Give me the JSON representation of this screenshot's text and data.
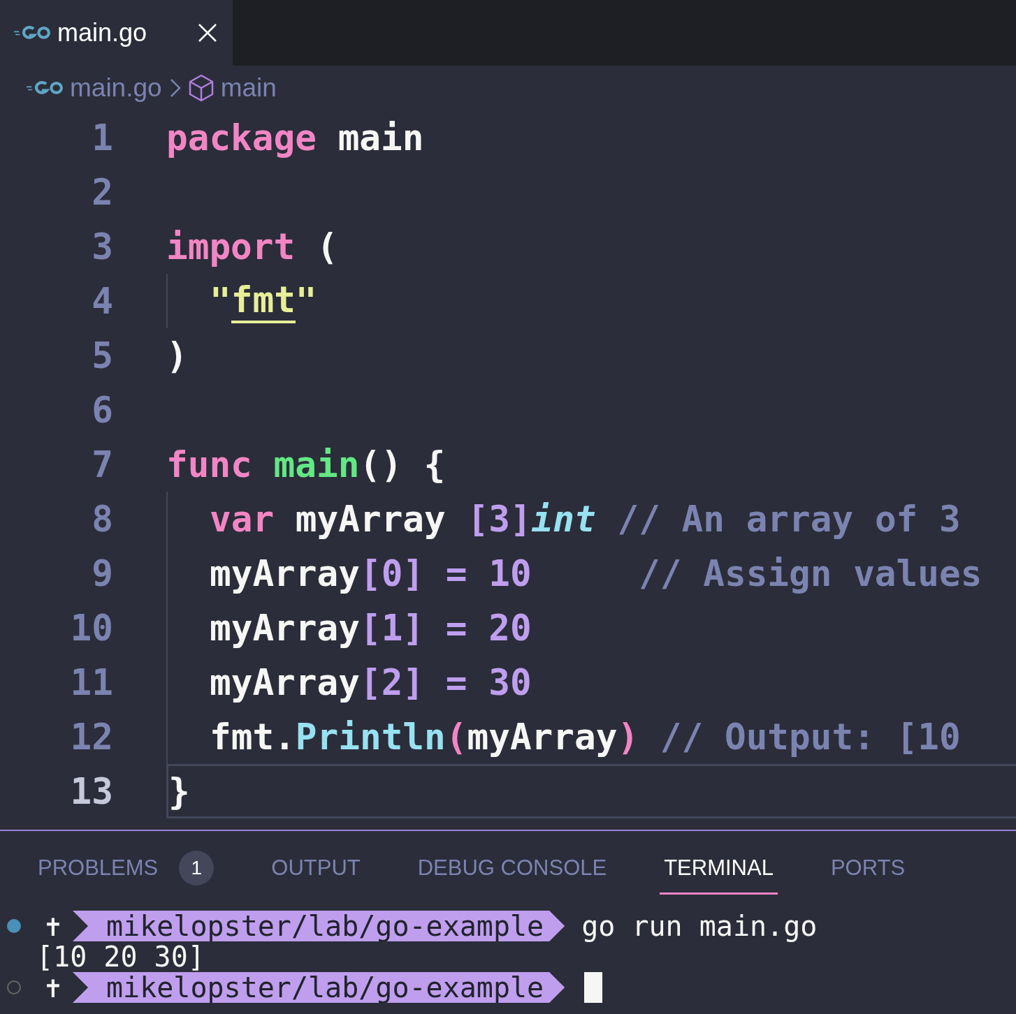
{
  "tab": {
    "label": "main.go",
    "selected": true
  },
  "breadcrumb": [
    {
      "kind": "file",
      "label": "main.go"
    },
    {
      "kind": "symbol",
      "label": "main"
    }
  ],
  "code": [
    {
      "number": "1",
      "indented": false,
      "current": false,
      "tokens": [
        {
          "text": "package",
          "kind": "keyword"
        },
        {
          "text": " main",
          "kind": "plain"
        }
      ]
    },
    {
      "number": "2",
      "current": false
    },
    {
      "number": "3",
      "indented": false,
      "current": false,
      "tokens": [
        {
          "text": "import",
          "kind": "keyword"
        },
        {
          "text": " (",
          "kind": "plain"
        }
      ]
    },
    {
      "number": "4",
      "indented": true,
      "current": false,
      "tokens": [
        {
          "text": "\"",
          "kind": "string"
        },
        {
          "text": "fmt",
          "kind": "string",
          "warning": true
        },
        {
          "text": "\"",
          "kind": "string"
        }
      ]
    },
    {
      "number": "5",
      "indented": false,
      "current": false,
      "tokens": [
        {
          "text": ")",
          "kind": "plain"
        }
      ]
    },
    {
      "number": "6",
      "current": false
    },
    {
      "number": "7",
      "indented": false,
      "current": false,
      "tokens": [
        {
          "text": "func ",
          "kind": "keyword"
        },
        {
          "text": "main",
          "kind": "function"
        },
        {
          "text": "() {",
          "kind": "plain"
        }
      ]
    },
    {
      "number": "8",
      "indented": true,
      "current": false,
      "tokens": [
        {
          "text": "var",
          "kind": "keyword"
        },
        {
          "text": " myArray ",
          "kind": "plain"
        },
        {
          "text": "[3]",
          "kind": "number"
        },
        {
          "text": "int",
          "kind": "type"
        },
        {
          "text": " // An array of 3",
          "kind": "comment"
        }
      ]
    },
    {
      "number": "9",
      "indented": true,
      "current": false,
      "tokens": [
        {
          "text": "myArray",
          "kind": "plain"
        },
        {
          "text": "[0]",
          "kind": "number"
        },
        {
          "text": " = 10",
          "kind": "number"
        },
        {
          "text": "     // Assign values",
          "kind": "comment"
        }
      ]
    },
    {
      "number": "10",
      "indented": true,
      "current": false,
      "tokens": [
        {
          "text": "myArray",
          "kind": "plain"
        },
        {
          "text": "[1]",
          "kind": "number"
        },
        {
          "text": " = 20",
          "kind": "number"
        }
      ]
    },
    {
      "number": "11",
      "indented": true,
      "current": false,
      "tokens": [
        {
          "text": "myArray",
          "kind": "plain"
        },
        {
          "text": "[2]",
          "kind": "number"
        },
        {
          "text": " = 30",
          "kind": "number"
        }
      ]
    },
    {
      "number": "12",
      "indented": true,
      "current": false,
      "tokens": [
        {
          "text": "fmt.",
          "kind": "plain"
        },
        {
          "text": "Println",
          "kind": "method"
        },
        {
          "text": "(",
          "kind": "keyword"
        },
        {
          "text": "myArray",
          "kind": "plain"
        },
        {
          "text": ")",
          "kind": "keyword"
        },
        {
          "text": " // Output: [10",
          "kind": "comment"
        }
      ]
    },
    {
      "number": "13",
      "indented": false,
      "current": true,
      "tokens": [
        {
          "text": "}",
          "kind": "plain"
        }
      ]
    }
  ],
  "panel_tabs": [
    {
      "label": "PROBLEMS",
      "badge": "1",
      "selected": false
    },
    {
      "label": "OUTPUT",
      "selected": false
    },
    {
      "label": "DEBUG CONSOLE",
      "selected": false
    },
    {
      "label": "TERMINAL",
      "selected": true
    },
    {
      "label": "PORTS",
      "selected": false
    }
  ],
  "terminal": [
    {
      "kind": "prompt",
      "done": true,
      "symbol": "✝",
      "path": "mikelopster/lab/go-example",
      "command": "go run main.go"
    },
    {
      "kind": "output",
      "text": "[10 20 30]"
    },
    {
      "kind": "prompt",
      "done": false,
      "symbol": "✝",
      "path": "mikelopster/lab/go-example",
      "cursor": true
    }
  ]
}
